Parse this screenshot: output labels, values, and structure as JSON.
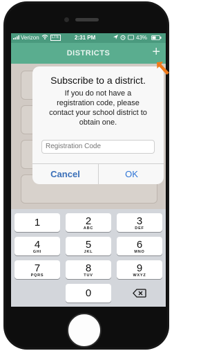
{
  "status_bar": {
    "carrier": "Verizon",
    "network": "LTE",
    "time": "2:31 PM",
    "battery": "43%"
  },
  "nav": {
    "title": "DISTRICTS",
    "add_icon": "plus-icon"
  },
  "dialog": {
    "title": "Subscribe to a district.",
    "message_lines": [
      "If you do not have a",
      "registration code, please",
      "contact your school district to",
      "obtain one."
    ],
    "input_placeholder": "Registration Code",
    "cancel_label": "Cancel",
    "ok_label": "OK"
  },
  "keypad": {
    "keys": [
      {
        "num": "1",
        "letters": ""
      },
      {
        "num": "2",
        "letters": "ABC"
      },
      {
        "num": "3",
        "letters": "DEF"
      },
      {
        "num": "4",
        "letters": "GHI"
      },
      {
        "num": "5",
        "letters": "JKL"
      },
      {
        "num": "6",
        "letters": "MNO"
      },
      {
        "num": "7",
        "letters": "PQRS"
      },
      {
        "num": "8",
        "letters": "TUV"
      },
      {
        "num": "9",
        "letters": "WXYZ"
      },
      {
        "num": "0",
        "letters": ""
      }
    ],
    "backspace_icon": "backspace-icon"
  },
  "colors": {
    "nav_green": "#5aad8f",
    "status_green": "#4a9a7e",
    "button_blue": "#2e74d6",
    "arrow_orange": "#f07a1a"
  }
}
